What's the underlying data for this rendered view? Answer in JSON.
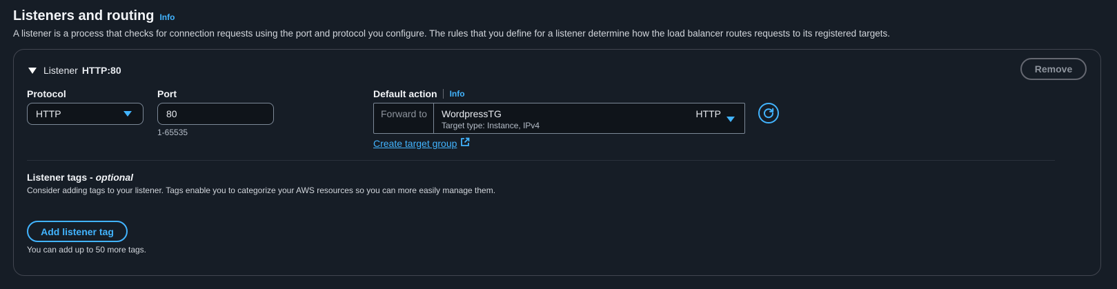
{
  "section": {
    "title": "Listeners and routing",
    "info_label": "Info",
    "description": "A listener is a process that checks for connection requests using the port and protocol you configure. The rules that you define for a listener determine how the load balancer routes requests to its registered targets."
  },
  "listener": {
    "label": "Listener",
    "value": "HTTP:80",
    "remove_label": "Remove",
    "protocol": {
      "label": "Protocol",
      "selected": "HTTP"
    },
    "port": {
      "label": "Port",
      "value": "80",
      "hint": "1-65535"
    },
    "default_action": {
      "label": "Default action",
      "info_label": "Info",
      "forward_to_label": "Forward to",
      "target_group_name": "WordpressTG",
      "target_group_details": "Target type: Instance, IPv4",
      "target_group_protocol": "HTTP",
      "create_target_group_label": "Create target group"
    },
    "tags": {
      "title": "Listener tags - ",
      "title_optional": "optional",
      "description": "Consider adding tags to your listener. Tags enable you to categorize your AWS resources so you can more easily manage them.",
      "add_label": "Add listener tag",
      "limit_text": "You can add up to 50 more tags."
    }
  },
  "icons": {
    "collapse": "caret-down-icon",
    "dropdown": "triangle-down-icon",
    "refresh": "refresh-icon",
    "external_link": "external-link-icon"
  },
  "colors": {
    "background": "#161d26",
    "accent": "#42b4ff",
    "border": "#424650"
  }
}
